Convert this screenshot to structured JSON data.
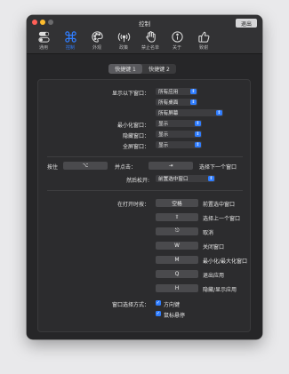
{
  "window": {
    "title": "控制",
    "quit_label": "退出"
  },
  "toolbar": [
    {
      "label": "通用",
      "icon": "toggle-icon"
    },
    {
      "label": "控制",
      "icon": "command-icon"
    },
    {
      "label": "外观",
      "icon": "palette-icon"
    },
    {
      "label": "政策",
      "icon": "broadcast-icon"
    },
    {
      "label": "禁止名单",
      "icon": "hand-icon"
    },
    {
      "label": "关于",
      "icon": "info-icon"
    },
    {
      "label": "致谢",
      "icon": "thumbs-up-icon"
    }
  ],
  "tabs": [
    "快捷键 1",
    "快捷键 2"
  ],
  "settings": {
    "show_windows_label": "显示以下窗口：",
    "apps_popup": "所有应用",
    "desktops_popup": "所有桌面",
    "screens_popup": "所有屏幕",
    "minimized_label": "最小化窗口：",
    "minimized_popup": "显示",
    "hidden_label": "隐藏窗口：",
    "hidden_popup": "显示",
    "fullscreen_label": "全屏窗口：",
    "fullscreen_popup": "显示",
    "hold_label": "按住",
    "hold_key": "⌥",
    "and_press_label": "并点击：",
    "next_key": "⇥",
    "next_action": "选择下一个窗口",
    "release_label": "然后松开:",
    "release_popup": "前置选中窗口"
  },
  "while_open": {
    "label": "在打开时按：",
    "rows": [
      {
        "key": "空格",
        "action": "前置选中窗口"
      },
      {
        "key": "⇧",
        "action": "选择上一个窗口"
      },
      {
        "key": "⎋",
        "action": "取消"
      },
      {
        "key": "W",
        "action": "关闭窗口"
      },
      {
        "key": "M",
        "action": "最小化/最大化窗口"
      },
      {
        "key": "Q",
        "action": "退出应用"
      },
      {
        "key": "H",
        "action": "隐藏/显示应用"
      }
    ]
  },
  "selection": {
    "label": "窗口选择方式：",
    "options": [
      "方向键",
      "鼠标悬停"
    ]
  },
  "colors": {
    "accent": "#2f7dff"
  }
}
